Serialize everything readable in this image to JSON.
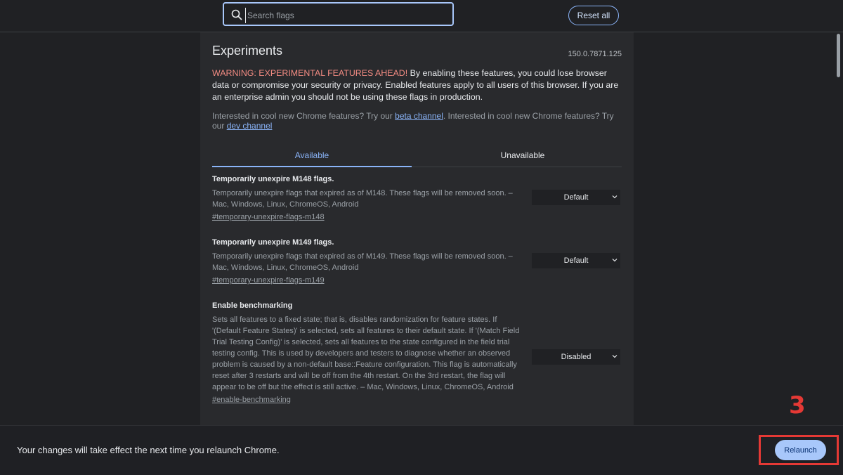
{
  "header": {
    "search_placeholder": "Search flags",
    "reset_all_label": "Reset all"
  },
  "main": {
    "title": "Experiments",
    "version": "150.0.7871.125",
    "warning_prefix": "WARNING: EXPERIMENTAL FEATURES AHEAD!",
    "warning_text": " By enabling these features, you could lose browser data or compromise your security or privacy. Enabled features apply to all users of this browser. If you are an enterprise admin you should not be using these flags in production.",
    "interest_part1": "Interested in cool new Chrome features? Try our ",
    "beta_link": "beta channel",
    "interest_part2": ". Interested in cool new Chrome features? Try our ",
    "dev_link": "dev channel",
    "tabs": [
      {
        "label": "Available",
        "active": true
      },
      {
        "label": "Unavailable",
        "active": false
      }
    ],
    "flags": [
      {
        "title": "Temporarily unexpire M148 flags.",
        "description": "Temporarily unexpire flags that expired as of M148. These flags will be removed soon. – Mac, Windows, Linux, ChromeOS, Android",
        "link": "#temporary-unexpire-flags-m148",
        "value": "Default"
      },
      {
        "title": "Temporarily unexpire M149 flags.",
        "description": "Temporarily unexpire flags that expired as of M149. These flags will be removed soon. – Mac, Windows, Linux, ChromeOS, Android",
        "link": "#temporary-unexpire-flags-m149",
        "value": "Default"
      },
      {
        "title": "Enable benchmarking",
        "description": "Sets all features to a fixed state; that is, disables randomization for feature states. If '(Default Feature States)' is selected, sets all features to their default state. If '(Match Field Trial Testing Config)' is selected, sets all features to the state configured in the field trial testing config. This is used by developers and testers to diagnose whether an observed problem is caused by a non-default base::Feature configuration. This flag is automatically reset after 3 restarts and will be off from the 4th restart. On the 3rd restart, the flag will appear to be off but the effect is still active. – Mac, Windows, Linux, ChromeOS, Android",
        "link": "#enable-benchmarking",
        "value": "Disabled"
      }
    ]
  },
  "bottom_bar": {
    "message": "Your changes will take effect the next time you relaunch Chrome.",
    "relaunch_label": "Relaunch"
  },
  "annotation": {
    "step_number": "3",
    "color": "#e53935"
  },
  "colors": {
    "accent": "#8ab4f8",
    "warning": "#f28b82",
    "background": "#202124",
    "panel": "#292a2d"
  }
}
